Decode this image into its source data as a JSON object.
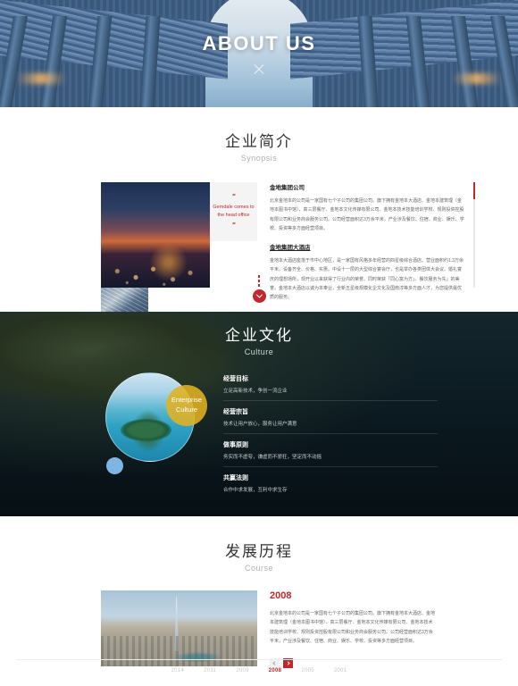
{
  "hero": {
    "title": "ABOUT US",
    "decor_icon": "close-x-icon"
  },
  "synopsis": {
    "title_cn": "企业简介",
    "title_en": "Synopsis",
    "quote": {
      "open_mark": "\"",
      "text": "Gemdale comes to the head office",
      "close_mark": "\""
    },
    "blocks": [
      {
        "heading": "金地集团公司",
        "body": "北京金地本的公司是一家国有七个子公司的集团公司。旗下拥有金地本大酒店、金地本建筑理（金地本图书中馆）、高三层餐厅、金地本文化传媒有限公司、金地本技术技能培训学校、规则投资控股有限公司和业务商会服务公司。公司经营面积达3万余平米，产业涉及餐饮、住宿、商业、娱乐、学校、投资等多方面经营项目。"
      },
      {
        "heading": "金地集团大酒店",
        "body": "金地本大酒店座落于市中心地区，是一家国有风格多年经营的四星级综合酒店。营业面积约1.3万余平米，设备齐全、价格、实惠。中设十一层的大型综合宴会厅，也是举办各类团体大会议、婚礼宴庆的理想场所，现开业以来获得了行业内的荣誉。同时荣获「同心富为方」、餐饮服务为先」的美誉。金地本大酒店以诚为本奉业，全新五星级规模化企文化及国南淳等多方面人才，为您提供最优质的服务。"
      }
    ],
    "scroll_icon": "scrollbar-thumb",
    "down_button_icon": "chevron-down-icon"
  },
  "culture": {
    "title_cn": "企业文化",
    "title_en": "Culture",
    "badge_line1": "Enterprise",
    "badge_line2": "Culture",
    "items": [
      {
        "title": "经营目标",
        "desc": "立足高新技术，争创一流企业"
      },
      {
        "title": "经营宗旨",
        "desc": "技术让用户放心，服务让用户满意"
      },
      {
        "title": "做事原则",
        "desc": "务实而不虚夸，谦虚而不骄狂，坚定而不动摇"
      },
      {
        "title": "共赢法则",
        "desc": "合作中求发展，互利中求生存"
      }
    ]
  },
  "course": {
    "title_cn": "发展历程",
    "title_en": "Course",
    "year": "2008",
    "body": "北京金地本的公司是一家国有七个子公司的集团公司。旗下拥有金地本大酒店、金地本建筑理（金地本图书中馆）、高三层餐厅、金地本文化传媒有限公司、金地本技术技能培训学校、规则投资控股有限公司和业务商会服务公司。公司经营面积达3万余平米，产业涉及餐饮、住宿、商业、娱乐、学校、投资等多方面经营项目。",
    "prev_icon": "chevron-left-icon",
    "next_icon": "chevron-right-icon",
    "timeline": [
      {
        "year": "2014",
        "active": false
      },
      {
        "year": "2011",
        "active": false
      },
      {
        "year": "2009",
        "active": false
      },
      {
        "year": "2008",
        "active": true
      },
      {
        "year": "2005",
        "active": false
      },
      {
        "year": "2001",
        "active": false
      }
    ]
  },
  "colors": {
    "accent_red": "#c1272d",
    "accent_gold": "#e1b222",
    "dark_bg": "#0c1b22"
  }
}
